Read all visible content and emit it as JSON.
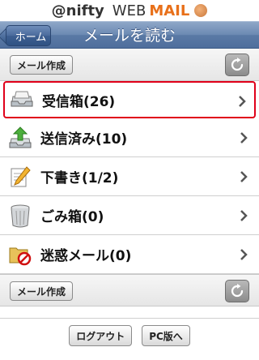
{
  "logo": {
    "nifty": "@nifty",
    "web": "WEB",
    "mail": "MAIL"
  },
  "header": {
    "back_label": "ホーム",
    "title": "メールを読む"
  },
  "toolbar": {
    "compose_label": "メール作成"
  },
  "folders": [
    {
      "label": "受信箱(26)",
      "icon": "inbox-icon"
    },
    {
      "label": "送信済み(10)",
      "icon": "sent-icon"
    },
    {
      "label": "下書き(1/2)",
      "icon": "draft-icon"
    },
    {
      "label": "ごみ箱(0)",
      "icon": "trash-icon"
    },
    {
      "label": "迷惑メール(0)",
      "icon": "spam-icon"
    }
  ],
  "footer": {
    "logout_label": "ログアウト",
    "pc_label": "PC版へ"
  },
  "colors": {
    "header_blue": "#5a7aa6",
    "highlight_red": "#e0001a",
    "mail_orange": "#e8701a"
  }
}
